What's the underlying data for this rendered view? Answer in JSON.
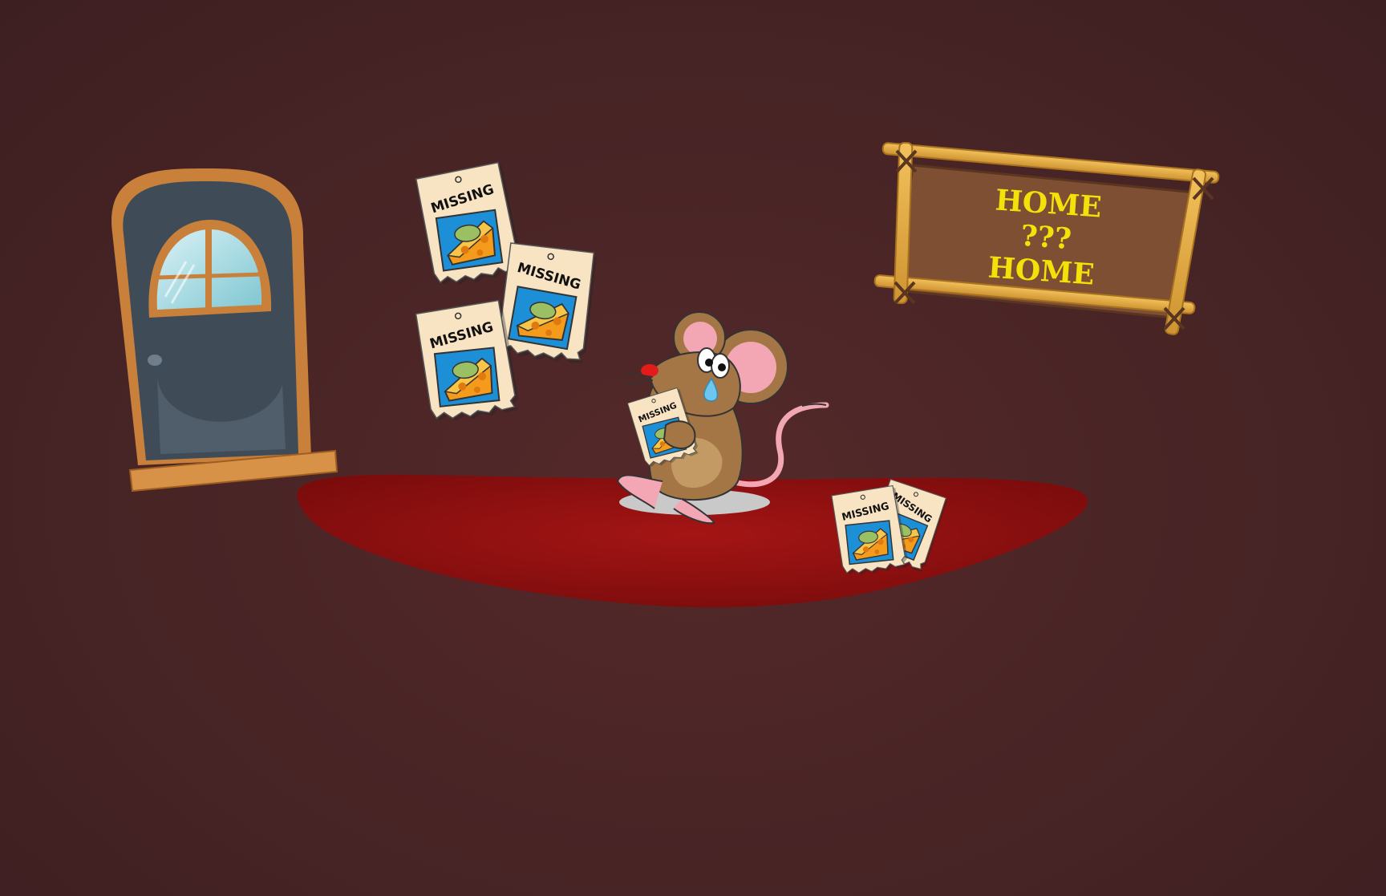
{
  "scene": {
    "background_color": "#4a2526",
    "rug_color": "#9c1010"
  },
  "sign": {
    "lines": [
      "HOME",
      "???",
      "HOME"
    ],
    "text_color": "#f5e10a",
    "board_color": "#7e4f33",
    "frame_color": "#e5b24d"
  },
  "posters": {
    "label": "MISSING",
    "wall_count": 3,
    "floor_count": 2,
    "held_count": 1
  },
  "door": {
    "color": "#3f4c58",
    "frame_color": "#c8803a"
  },
  "mouse": {
    "state": "crying"
  }
}
